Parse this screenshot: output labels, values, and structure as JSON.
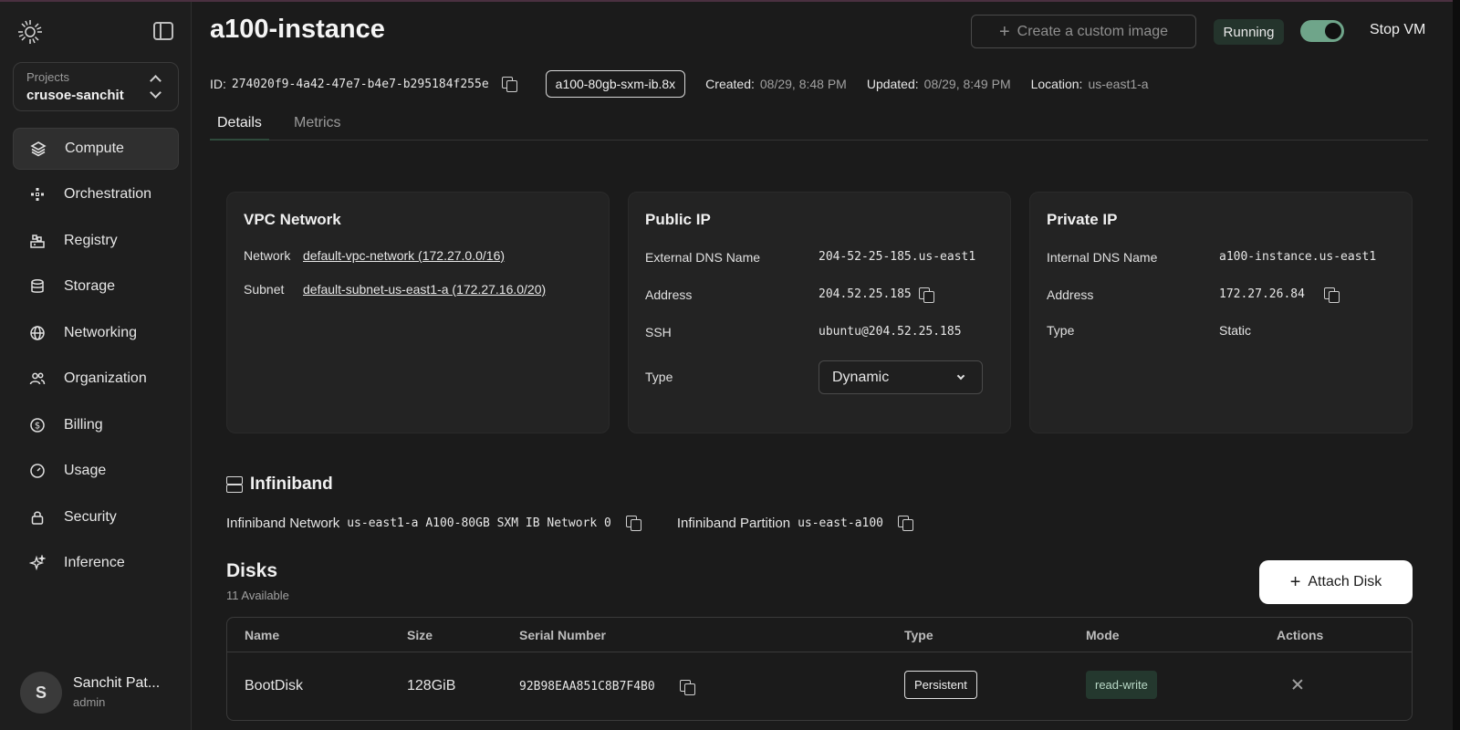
{
  "sidebar": {
    "project_label": "Projects",
    "project_name": "crusoe-sanchit",
    "items": [
      {
        "label": "Compute",
        "icon": "layers-icon",
        "active": true
      },
      {
        "label": "Orchestration",
        "icon": "orchestration-icon"
      },
      {
        "label": "Registry",
        "icon": "registry-icon"
      },
      {
        "label": "Storage",
        "icon": "database-icon"
      },
      {
        "label": "Networking",
        "icon": "globe-icon"
      },
      {
        "label": "Organization",
        "icon": "users-icon"
      },
      {
        "label": "Billing",
        "icon": "dollar-icon"
      },
      {
        "label": "Usage",
        "icon": "gauge-icon"
      },
      {
        "label": "Security",
        "icon": "lock-icon"
      },
      {
        "label": "Inference",
        "icon": "sparkle-icon"
      }
    ],
    "user": {
      "initial": "S",
      "name": "Sanchit Pat...",
      "role": "admin"
    }
  },
  "header": {
    "title": "a100-instance",
    "create_image_label": "Create a custom image",
    "status": "Running",
    "stop_label": "Stop VM",
    "id_label": "ID:",
    "id_value": "274020f9-4a42-47e7-b4e7-b295184f255e",
    "machine_type": "a100-80gb-sxm-ib.8x",
    "created_label": "Created:",
    "created_value": "08/29, 8:48 PM",
    "updated_label": "Updated:",
    "updated_value": "08/29, 8:49 PM",
    "location_label": "Location:",
    "location_value": "us-east1-a"
  },
  "tabs": [
    "Details",
    "Metrics"
  ],
  "vpc": {
    "title": "VPC Network",
    "network_label": "Network",
    "network_value": "default-vpc-network (172.27.0.0/16)",
    "subnet_label": "Subnet",
    "subnet_value": "default-subnet-us-east1-a (172.27.16.0/20)"
  },
  "public_ip": {
    "title": "Public IP",
    "dns_label": "External DNS Name",
    "dns_value": "204-52-25-185.us-east1",
    "address_label": "Address",
    "address_value": "204.52.25.185",
    "ssh_label": "SSH",
    "ssh_value": "ubuntu@204.52.25.185",
    "type_label": "Type",
    "type_value": "Dynamic"
  },
  "private_ip": {
    "title": "Private IP",
    "dns_label": "Internal DNS Name",
    "dns_value": "a100-instance.us-east1",
    "address_label": "Address",
    "address_value": "172.27.26.84",
    "type_label": "Type",
    "type_value": "Static"
  },
  "infiniband": {
    "title": "Infiniband",
    "network_label": "Infiniband Network",
    "network_value": "us-east1-a A100-80GB SXM IB Network 0",
    "partition_label": "Infiniband Partition",
    "partition_value": "us-east-a100"
  },
  "disks": {
    "title": "Disks",
    "available": "11 Available",
    "attach_label": "Attach Disk",
    "columns": [
      "Name",
      "Size",
      "Serial Number",
      "Type",
      "Mode",
      "Actions"
    ],
    "rows": [
      {
        "name": "BootDisk",
        "size": "128GiB",
        "serial": "92B98EAA851C8B7F4B0",
        "type": "Persistent",
        "mode": "read-write"
      }
    ]
  },
  "colors": {
    "accent_green": "#6fa58a",
    "background": "#1b1b1b"
  }
}
